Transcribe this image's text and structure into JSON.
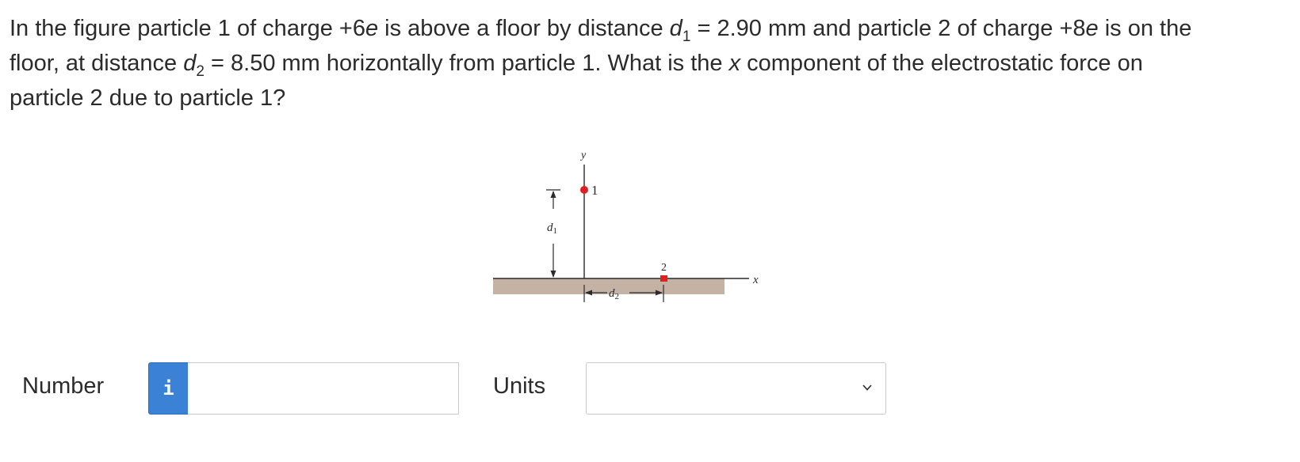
{
  "question": {
    "line1_parts": [
      "In the figure particle 1 of charge +6",
      "e",
      " is above a floor by distance ",
      "d",
      "1",
      " = 2.90 mm and particle 2 of charge +8",
      "e",
      " is on the"
    ],
    "line2_parts": [
      "floor, at distance ",
      "d",
      "2",
      " = 8.50 mm horizontally from particle 1. What is the ",
      "x",
      " component of the electrostatic force on"
    ],
    "line3": "particle 2 due to particle 1?"
  },
  "figure": {
    "y_axis_label": "y",
    "x_axis_label": "x",
    "particle1_label": "1",
    "particle2_label": "2",
    "d1_label": "d",
    "d1_sub": "1",
    "d2_label": "d",
    "d2_sub": "2",
    "colors": {
      "floor": "#c4b3a5",
      "particle": "#e02020",
      "lines": "#2b2b2b"
    }
  },
  "answer": {
    "number_label": "Number",
    "info_icon": "i",
    "number_value": "",
    "units_label": "Units",
    "units_selected": ""
  },
  "colors": {
    "info_button": "#3b82d6",
    "border": "#c9c9c9",
    "text": "#2b2b2b"
  }
}
